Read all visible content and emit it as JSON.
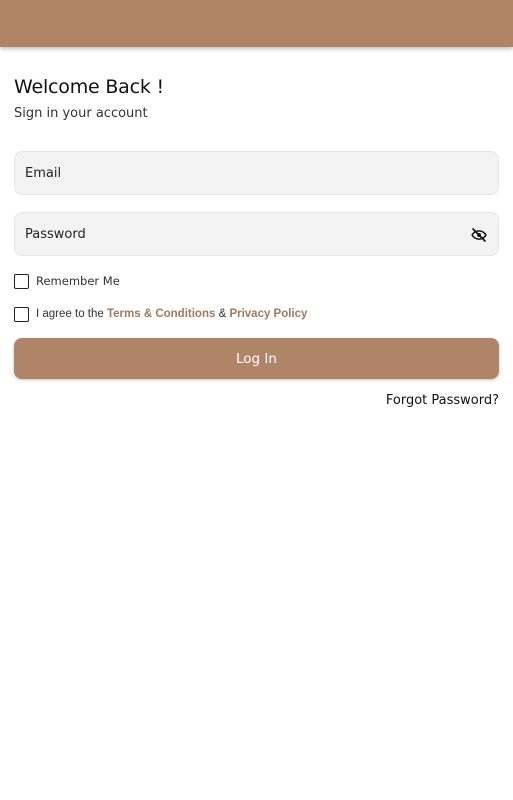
{
  "colors": {
    "accent": "#b08467",
    "link": "#a07a5c",
    "field_background": "#f3f3f3"
  },
  "header": {
    "title": "Welcome Back !",
    "subtitle": "Sign in your account"
  },
  "form": {
    "email": {
      "placeholder": "Email",
      "value": ""
    },
    "password": {
      "placeholder": "Password",
      "value": "",
      "toggle_icon": "eye-off-icon"
    },
    "remember_me": {
      "label": "Remember Me",
      "checked": false
    },
    "agree": {
      "checked": false,
      "prefix": "I agree to the ",
      "terms_link": "Terms & Conditions",
      "conjunction": " & ",
      "privacy_link": "Privacy Policy"
    },
    "login_button_label": "Log In",
    "forgot_password_label": "Forgot Password?"
  }
}
